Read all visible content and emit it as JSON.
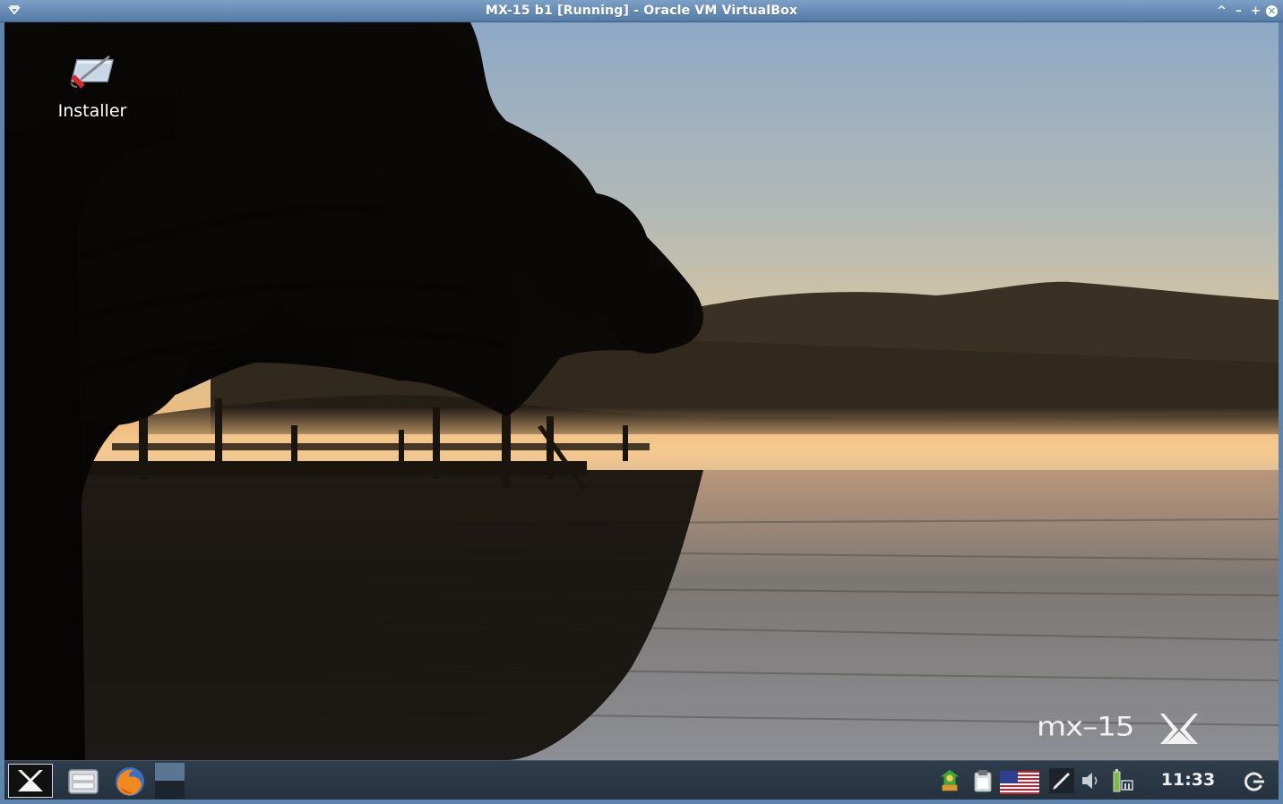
{
  "window": {
    "title": "MX-15 b1 [Running] - Oracle VM VirtualBox"
  },
  "titlebar_controls": [
    "menu-icon",
    "shade-icon",
    "minimize-icon",
    "maximize-icon",
    "close-icon"
  ],
  "desktop": {
    "icons": [
      {
        "label": "Installer",
        "icon": "installer-icon"
      }
    ],
    "brand_text": "mx–15",
    "brand_logo": "mx-logo-icon"
  },
  "taskbar": {
    "launchers": [
      {
        "icon": "mx-menu-icon"
      },
      {
        "icon": "file-manager-icon"
      },
      {
        "icon": "firefox-icon"
      }
    ],
    "tray_icons": [
      "update-notifier-icon",
      "clipboard-icon",
      "us-flag-keyboard-icon",
      "pen-icon",
      "volume-icon",
      "battery-network-icon"
    ],
    "clock": "11:33",
    "power_icon": "logout-icon"
  },
  "colors": {
    "titlebar": "#5e84ad",
    "taskbar": "#2a3744"
  }
}
